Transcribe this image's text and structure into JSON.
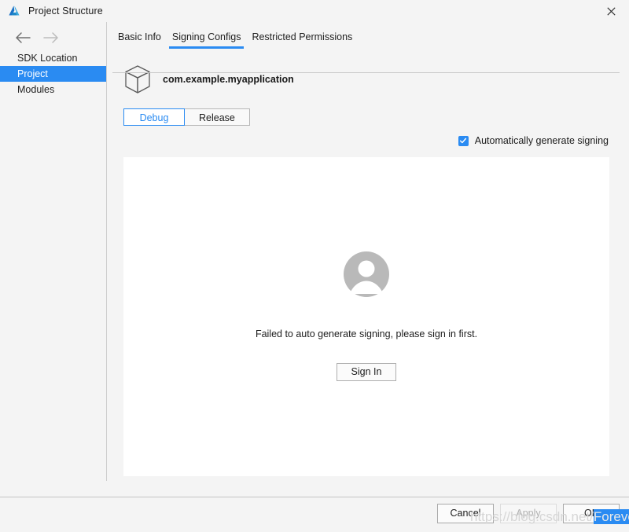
{
  "window": {
    "title": "Project Structure",
    "logo_icon": "android-studio-logo-icon",
    "close_icon": "close-icon",
    "accent_color": "#2a8bf2"
  },
  "sidebar": {
    "back_icon": "arrow-left-icon",
    "forward_icon": "arrow-right-icon",
    "items": [
      {
        "label": "SDK Location",
        "selected": false
      },
      {
        "label": "Project",
        "selected": true
      },
      {
        "label": "Modules",
        "selected": false
      }
    ]
  },
  "main": {
    "tabs": [
      {
        "label": "Basic Info",
        "active": false
      },
      {
        "label": "Signing Configs",
        "active": true
      },
      {
        "label": "Restricted Permissions",
        "active": false
      }
    ],
    "package": {
      "icon": "cube-icon",
      "name": "com.example.myapplication"
    },
    "build_variants": [
      {
        "label": "Debug",
        "selected": true
      },
      {
        "label": "Release",
        "selected": false
      }
    ],
    "auto_generate": {
      "label": "Automatically generate signing",
      "checked": true,
      "check_icon": "checkmark-icon"
    },
    "panel": {
      "avatar_icon": "user-avatar-icon",
      "message": "Failed to auto generate signing, please sign in first.",
      "sign_in_label": "Sign In"
    }
  },
  "footer": {
    "buttons": [
      {
        "label": "Cancel",
        "state": "enabled"
      },
      {
        "label": "Apply",
        "state": "disabled"
      },
      {
        "label": "OK",
        "state": "enabled"
      }
    ]
  },
  "watermark": {
    "prefix": "https://blog.csdn.net/",
    "selected": "Forever_wj"
  }
}
